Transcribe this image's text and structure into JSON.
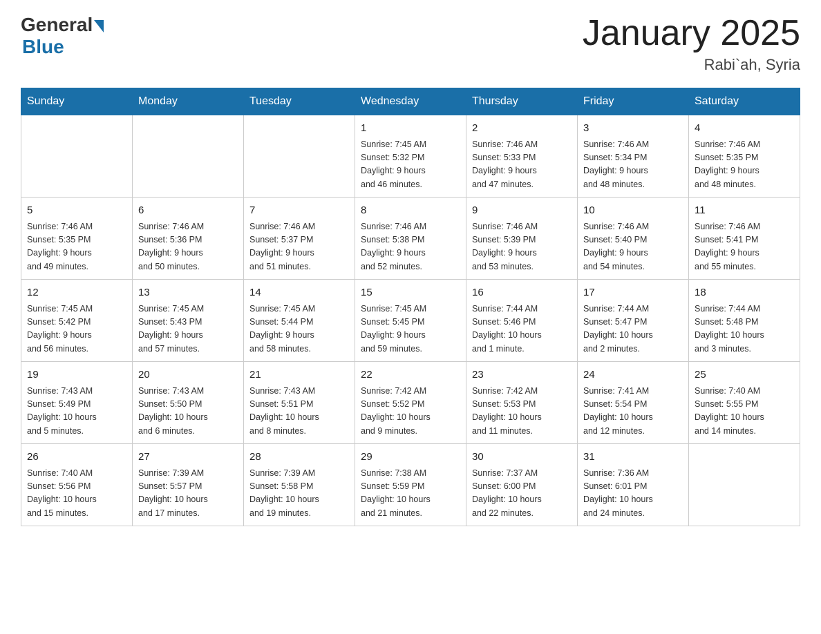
{
  "header": {
    "logo_general": "General",
    "logo_blue": "Blue",
    "month_title": "January 2025",
    "location": "Rabi`ah, Syria"
  },
  "days_of_week": [
    "Sunday",
    "Monday",
    "Tuesday",
    "Wednesday",
    "Thursday",
    "Friday",
    "Saturday"
  ],
  "weeks": [
    [
      {
        "day": "",
        "info": ""
      },
      {
        "day": "",
        "info": ""
      },
      {
        "day": "",
        "info": ""
      },
      {
        "day": "1",
        "info": "Sunrise: 7:45 AM\nSunset: 5:32 PM\nDaylight: 9 hours\nand 46 minutes."
      },
      {
        "day": "2",
        "info": "Sunrise: 7:46 AM\nSunset: 5:33 PM\nDaylight: 9 hours\nand 47 minutes."
      },
      {
        "day": "3",
        "info": "Sunrise: 7:46 AM\nSunset: 5:34 PM\nDaylight: 9 hours\nand 48 minutes."
      },
      {
        "day": "4",
        "info": "Sunrise: 7:46 AM\nSunset: 5:35 PM\nDaylight: 9 hours\nand 48 minutes."
      }
    ],
    [
      {
        "day": "5",
        "info": "Sunrise: 7:46 AM\nSunset: 5:35 PM\nDaylight: 9 hours\nand 49 minutes."
      },
      {
        "day": "6",
        "info": "Sunrise: 7:46 AM\nSunset: 5:36 PM\nDaylight: 9 hours\nand 50 minutes."
      },
      {
        "day": "7",
        "info": "Sunrise: 7:46 AM\nSunset: 5:37 PM\nDaylight: 9 hours\nand 51 minutes."
      },
      {
        "day": "8",
        "info": "Sunrise: 7:46 AM\nSunset: 5:38 PM\nDaylight: 9 hours\nand 52 minutes."
      },
      {
        "day": "9",
        "info": "Sunrise: 7:46 AM\nSunset: 5:39 PM\nDaylight: 9 hours\nand 53 minutes."
      },
      {
        "day": "10",
        "info": "Sunrise: 7:46 AM\nSunset: 5:40 PM\nDaylight: 9 hours\nand 54 minutes."
      },
      {
        "day": "11",
        "info": "Sunrise: 7:46 AM\nSunset: 5:41 PM\nDaylight: 9 hours\nand 55 minutes."
      }
    ],
    [
      {
        "day": "12",
        "info": "Sunrise: 7:45 AM\nSunset: 5:42 PM\nDaylight: 9 hours\nand 56 minutes."
      },
      {
        "day": "13",
        "info": "Sunrise: 7:45 AM\nSunset: 5:43 PM\nDaylight: 9 hours\nand 57 minutes."
      },
      {
        "day": "14",
        "info": "Sunrise: 7:45 AM\nSunset: 5:44 PM\nDaylight: 9 hours\nand 58 minutes."
      },
      {
        "day": "15",
        "info": "Sunrise: 7:45 AM\nSunset: 5:45 PM\nDaylight: 9 hours\nand 59 minutes."
      },
      {
        "day": "16",
        "info": "Sunrise: 7:44 AM\nSunset: 5:46 PM\nDaylight: 10 hours\nand 1 minute."
      },
      {
        "day": "17",
        "info": "Sunrise: 7:44 AM\nSunset: 5:47 PM\nDaylight: 10 hours\nand 2 minutes."
      },
      {
        "day": "18",
        "info": "Sunrise: 7:44 AM\nSunset: 5:48 PM\nDaylight: 10 hours\nand 3 minutes."
      }
    ],
    [
      {
        "day": "19",
        "info": "Sunrise: 7:43 AM\nSunset: 5:49 PM\nDaylight: 10 hours\nand 5 minutes."
      },
      {
        "day": "20",
        "info": "Sunrise: 7:43 AM\nSunset: 5:50 PM\nDaylight: 10 hours\nand 6 minutes."
      },
      {
        "day": "21",
        "info": "Sunrise: 7:43 AM\nSunset: 5:51 PM\nDaylight: 10 hours\nand 8 minutes."
      },
      {
        "day": "22",
        "info": "Sunrise: 7:42 AM\nSunset: 5:52 PM\nDaylight: 10 hours\nand 9 minutes."
      },
      {
        "day": "23",
        "info": "Sunrise: 7:42 AM\nSunset: 5:53 PM\nDaylight: 10 hours\nand 11 minutes."
      },
      {
        "day": "24",
        "info": "Sunrise: 7:41 AM\nSunset: 5:54 PM\nDaylight: 10 hours\nand 12 minutes."
      },
      {
        "day": "25",
        "info": "Sunrise: 7:40 AM\nSunset: 5:55 PM\nDaylight: 10 hours\nand 14 minutes."
      }
    ],
    [
      {
        "day": "26",
        "info": "Sunrise: 7:40 AM\nSunset: 5:56 PM\nDaylight: 10 hours\nand 15 minutes."
      },
      {
        "day": "27",
        "info": "Sunrise: 7:39 AM\nSunset: 5:57 PM\nDaylight: 10 hours\nand 17 minutes."
      },
      {
        "day": "28",
        "info": "Sunrise: 7:39 AM\nSunset: 5:58 PM\nDaylight: 10 hours\nand 19 minutes."
      },
      {
        "day": "29",
        "info": "Sunrise: 7:38 AM\nSunset: 5:59 PM\nDaylight: 10 hours\nand 21 minutes."
      },
      {
        "day": "30",
        "info": "Sunrise: 7:37 AM\nSunset: 6:00 PM\nDaylight: 10 hours\nand 22 minutes."
      },
      {
        "day": "31",
        "info": "Sunrise: 7:36 AM\nSunset: 6:01 PM\nDaylight: 10 hours\nand 24 minutes."
      },
      {
        "day": "",
        "info": ""
      }
    ]
  ]
}
